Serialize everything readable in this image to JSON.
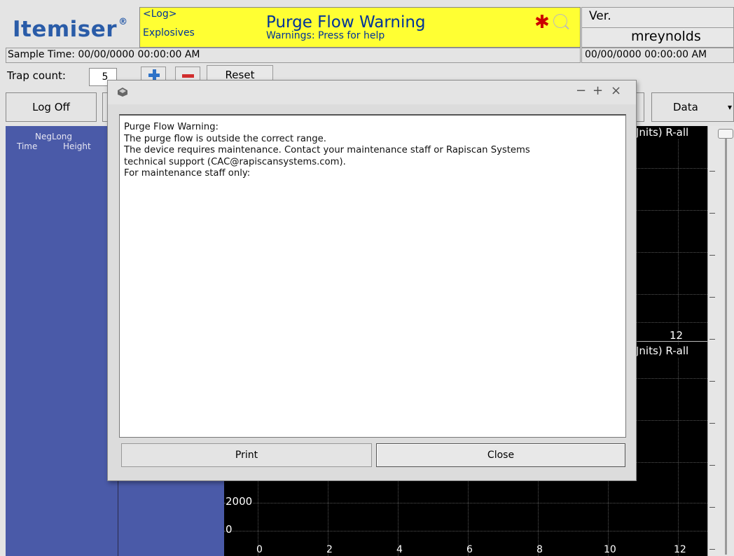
{
  "app": {
    "logo": "Itemiser",
    "logo_mark": "®"
  },
  "banner": {
    "log": "<Log>",
    "mode": "Explosives",
    "title": "Purge Flow Warning",
    "subtitle": "Warnings: Press for help",
    "bg_color": "#ffff33",
    "alert_icon": "asterisk-icon",
    "search_icon": "search-icon"
  },
  "version": {
    "label": "Ver.",
    "user": "mreynolds",
    "datetime": "00/00/0000  00:00:00 AM"
  },
  "sample_time": "Sample Time: 00/00/0000  00:00:00 AM",
  "trap": {
    "label": "Trap count:",
    "value": "5",
    "reset_label": "Reset"
  },
  "toolbar": {
    "logoff_label": "Log Off",
    "data_label": "Data"
  },
  "neg_panel": {
    "title": "NegLong",
    "col_time": "Time",
    "col_height": "Height"
  },
  "plot": {
    "upper_label": "Jnits) R-all",
    "lower_label": "Jnits) R-all",
    "upper_tick": "12",
    "y_labels": [
      "2000",
      "0"
    ],
    "x_ticks": [
      "0",
      "2",
      "4",
      "6",
      "8",
      "10",
      "12"
    ]
  },
  "dialog": {
    "lines": [
      "Purge Flow Warning:",
      "The purge flow is outside the correct range.",
      "The device requires maintenance. Contact your maintenance staff or Rapiscan Systems",
      "technical support (CAC@rapiscansystems.com).",
      "For maintenance staff only:"
    ],
    "print_label": "Print",
    "close_label": "Close",
    "min_glyph": "−",
    "max_glyph": "+",
    "close_glyph": "×"
  }
}
